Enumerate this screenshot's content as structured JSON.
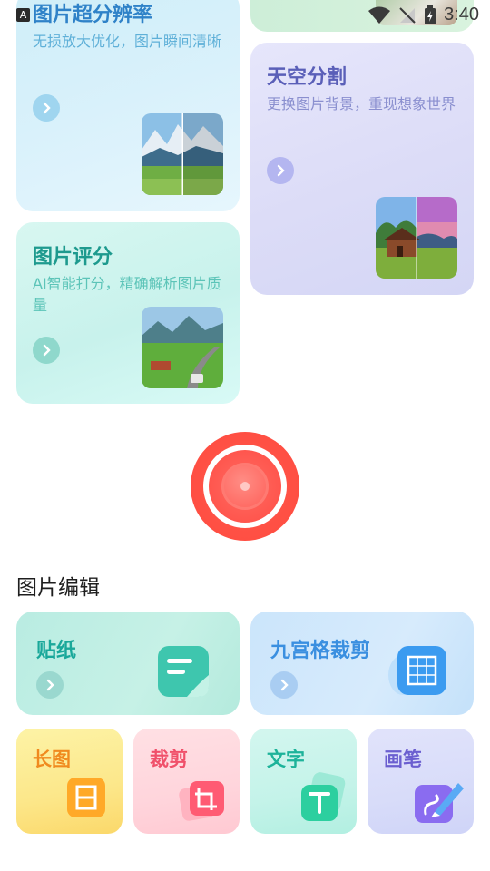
{
  "status_bar": {
    "badge": "A",
    "time": "3:40"
  },
  "features": {
    "super_resolution": {
      "title": "图片超分辨率",
      "desc": "无损放大优化，图片瞬间清晰"
    },
    "sky_segmentation": {
      "title": "天空分割",
      "desc": "更换图片背景，重现想象世界"
    },
    "image_score": {
      "title": "图片评分",
      "desc": "AI智能打分，精确解析图片质量"
    }
  },
  "editing": {
    "section_title": "图片编辑",
    "sticker": "贴纸",
    "grid_crop": "九宫格裁剪",
    "long_image": "长图",
    "crop": "裁剪",
    "text": "文字",
    "brush": "画笔"
  },
  "colors": {
    "accent_red": "#ff4a3e",
    "teal_title": "#1aa89a",
    "blue_title": "#3a8fe0",
    "purple_title": "#5a5fb8"
  }
}
